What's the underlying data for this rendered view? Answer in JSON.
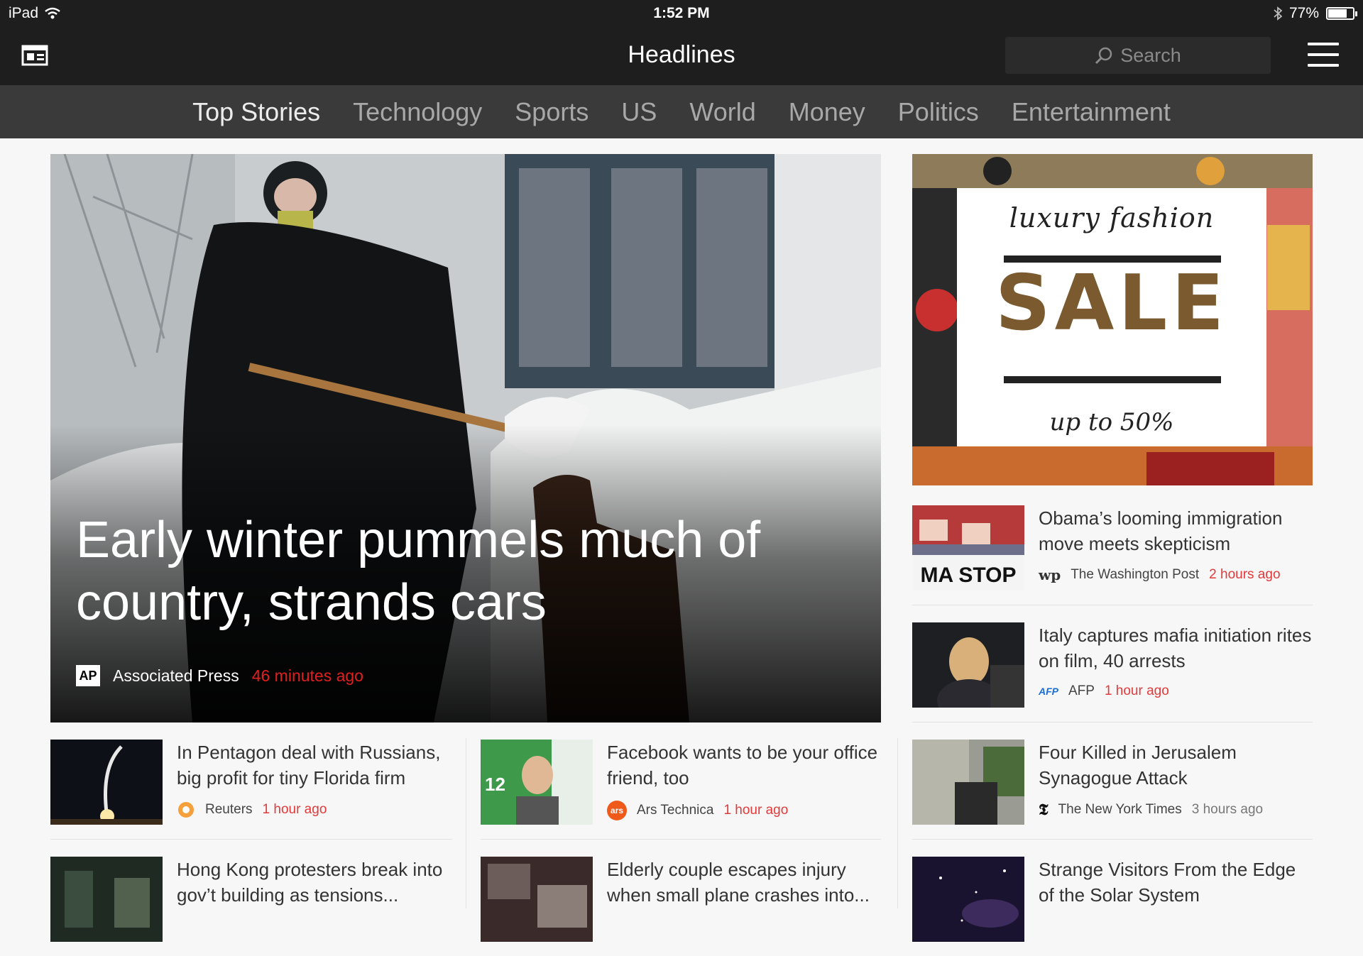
{
  "status_bar": {
    "device": "iPad",
    "time": "1:52 PM",
    "battery": "77%",
    "battery_level": 0.77
  },
  "header": {
    "title": "Headlines",
    "search_placeholder": "Search"
  },
  "tabs": [
    "Top Stories",
    "Technology",
    "Sports",
    "US",
    "World",
    "Money",
    "Politics",
    "Entertainment"
  ],
  "active_tab": "Top Stories",
  "hero": {
    "title": "Early winter pummels much of country, strands cars",
    "source_logo": "AP",
    "source": "Associated Press",
    "time": "46 minutes ago"
  },
  "ad": {
    "line1": "luxury fashion",
    "line2": "SALE",
    "line3": "up to 50%"
  },
  "right_stories": [
    {
      "headline": "Obama’s looming immigration move meets skepticism",
      "source_logo": "wp",
      "source": "The Washington Post",
      "time": "2 hours ago",
      "thumb_text": "MA STOP"
    },
    {
      "headline": "Italy captures mafia initiation rites on film, 40 arrests",
      "source_logo": "AFP",
      "source": "AFP",
      "time": "1 hour ago"
    },
    {
      "headline": "Four Killed in Jerusalem Synagogue Attack",
      "source_logo": "𝕿",
      "source": "The New York Times",
      "time": "3 hours ago"
    },
    {
      "headline": "Strange Visitors From the Edge of the Solar System"
    }
  ],
  "bottom_stories": [
    {
      "headline": "In Pentagon deal with Russians, big profit for tiny Florida firm",
      "source": "Reuters",
      "time": "1 hour ago"
    },
    {
      "headline": "Facebook wants to be your office friend, too",
      "source_logo": "ars",
      "source": "Ars Technica",
      "time": "1 hour ago",
      "thumb_text": "12"
    },
    {
      "headline": "Hong Kong protesters break into gov’t building as tensions..."
    },
    {
      "headline": "Elderly couple escapes injury when small plane crashes into..."
    }
  ],
  "colors": {
    "bar_dark": "#1e1e1e",
    "tab_bar": "#3a3a3a",
    "accent_red": "#e21f1f"
  },
  "icons": [
    "wifi-icon",
    "bluetooth-icon",
    "battery-icon",
    "layout-icon",
    "search-icon",
    "hamburger-menu-icon"
  ]
}
